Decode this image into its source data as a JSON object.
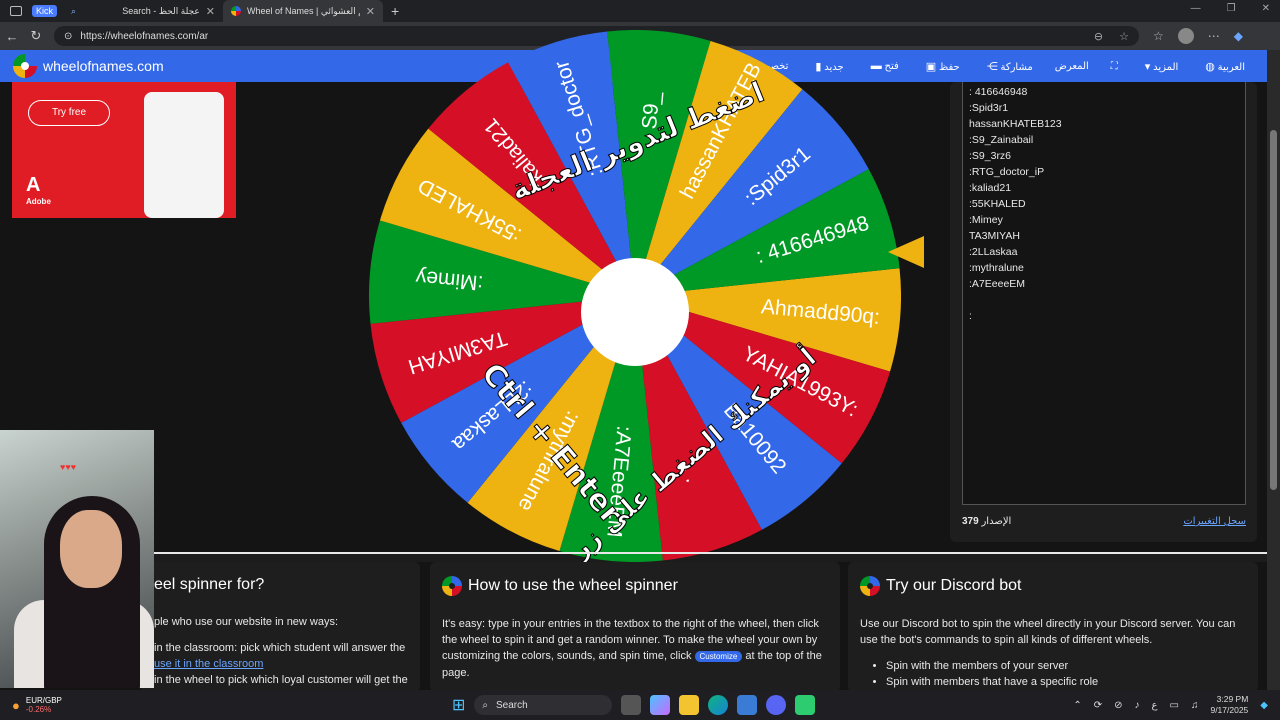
{
  "browser": {
    "kick_badge": "Kick",
    "tabs": [
      {
        "title": "Search - عجلة الحظ"
      },
      {
        "title": "Wheel of Names | الاسم العشوائي"
      }
    ],
    "url": "https://wheelofnames.com/ar"
  },
  "site": {
    "name": "wheelofnames.com",
    "menu": [
      {
        "label": "تخصيص",
        "icon": "palette-icon"
      },
      {
        "label": "جديد",
        "icon": "new-file-icon"
      },
      {
        "label": "فتح",
        "icon": "folder-open-icon"
      },
      {
        "label": "حفظ",
        "icon": "save-icon"
      },
      {
        "label": "مشاركة",
        "icon": "share-icon"
      },
      {
        "label": "المعرض",
        "icon": "gallery-icon"
      },
      {
        "label": "",
        "icon": "fullscreen-icon"
      },
      {
        "label": "المزيد",
        "icon": "caret-down-icon"
      },
      {
        "label": "العربية",
        "icon": "globe-icon"
      }
    ]
  },
  "ad": {
    "cta": "Try free",
    "brand": "Adobe"
  },
  "wheel": {
    "colors": [
      "#3369e8",
      "#d50f25",
      "#eeb211",
      "#009925"
    ],
    "segments": [
      "Ahmadd90q:",
      "YAHIA1993Y:",
      "Ba10092",
      ". .",
      ":A7EeeeEM",
      ":mythralune",
      ":2LLaskaa",
      "TA3MIYAH",
      ":Mimey",
      ":55KHALED",
      ":kaliad21",
      ":RTG_doctor",
      "S9_",
      "hassanKHATEB",
      ":Spid3r1",
      ": 416646948"
    ],
    "overlay_top": "اضغط لتدوير العجلة",
    "overlay_ctrl": "Ctrl + Enter",
    "overlay_bottom": "أو يمكنك الضغط على زر"
  },
  "entries": [
    ": 416646948",
    ":Spid3r1",
    "hassanKHATEB123",
    ":S9_Zainabail",
    ":S9_3rz6",
    ":RTG_doctor_iP",
    ":kaliad21",
    ":55KHALED",
    ":Mimey",
    "TA3MIYAH",
    ":2LLaskaa",
    ":mythralune",
    ":A7EeeeEM",
    "",
    ":"
  ],
  "panel": {
    "version_label": "الإصدار",
    "version_num": "379",
    "changelog": "سجل التغييرات"
  },
  "cards": {
    "c1": {
      "title": "eel spinner for?",
      "line1": "ple who use our website in new ways:",
      "line2": "in the classroom: pick which student will answer the",
      "link": "use it in the classroom",
      "line3": "in the wheel to pick which loyal customer will get the"
    },
    "c2": {
      "title": "How to use the wheel spinner",
      "p1": "It's easy: type in your entries in the textbox to the right of the wheel, then click the wheel to spin it and get a random winner. To make the wheel your own by customizing the colors, sounds, and spin time, click",
      "pill": "Customize",
      "p2": "at the top of the page."
    },
    "c3": {
      "title": "Try our Discord bot",
      "p1": "Use our Discord bot to spin the wheel directly in your Discord server. You can use the bot's commands to spin all kinds of different wheels.",
      "li1": "Spin with the members of your server",
      "li2": "Spin with members that have a specific role"
    }
  },
  "taskbar": {
    "ticker": "EUR/GBP",
    "change": "-0.26%",
    "search": "Search",
    "lang": "ع",
    "time": "3:29 PM",
    "date": "9/17/2025"
  }
}
